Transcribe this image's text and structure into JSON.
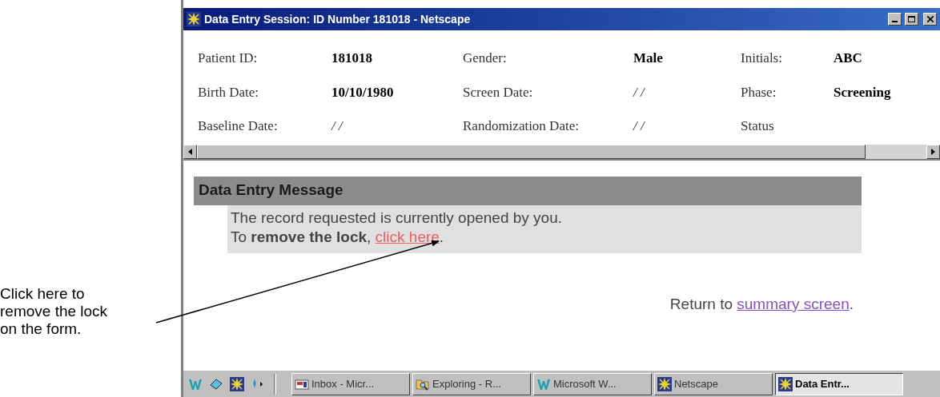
{
  "window": {
    "title": "Data Entry Session: ID Number 181018 - Netscape"
  },
  "patient_fields": [
    {
      "label": "Patient ID:",
      "value": "181018",
      "emphasized": true
    },
    {
      "label": "Gender:",
      "value": "Male",
      "emphasized": true
    },
    {
      "label": "Initials:",
      "value": "ABC",
      "emphasized": true
    },
    {
      "label": "Birth Date:",
      "value": "10/10/1980",
      "emphasized": true
    },
    {
      "label": "Screen Date:",
      "value": "/ /",
      "emphasized": false
    },
    {
      "label": "Phase:",
      "value": "Screening",
      "emphasized": true
    },
    {
      "label": "Baseline Date:",
      "value": "/ /",
      "emphasized": false
    },
    {
      "label": "Randomization Date:",
      "value": "/ /",
      "emphasized": false
    },
    {
      "label": "Status"
    }
  ],
  "message": {
    "header": "Data Entry Message",
    "line_1": "The record requested is currently opened by you.",
    "line_2_prefix": "To **remove the lock**, ",
    "line_2_link": "click here",
    "line_2_suffix": "."
  },
  "return_line": {
    "prefix": "Return to ",
    "link": "summary screen",
    "suffix": "."
  },
  "taskbar": {
    "tasks": [
      {
        "label": "Inbox - Micr...",
        "selected": false,
        "kind": "inbox"
      },
      {
        "label": "Exploring - R...",
        "selected": false,
        "kind": "folder"
      },
      {
        "label": "Microsoft W...",
        "selected": false,
        "kind": "word"
      },
      {
        "label": "Netscape",
        "selected": false,
        "kind": "netscape"
      },
      {
        "label": "Data Entr...",
        "selected": true,
        "kind": "netscape"
      }
    ]
  },
  "annotation": {
    "lines": [
      "Click here to",
      "remove the lock",
      "on the form."
    ]
  }
}
